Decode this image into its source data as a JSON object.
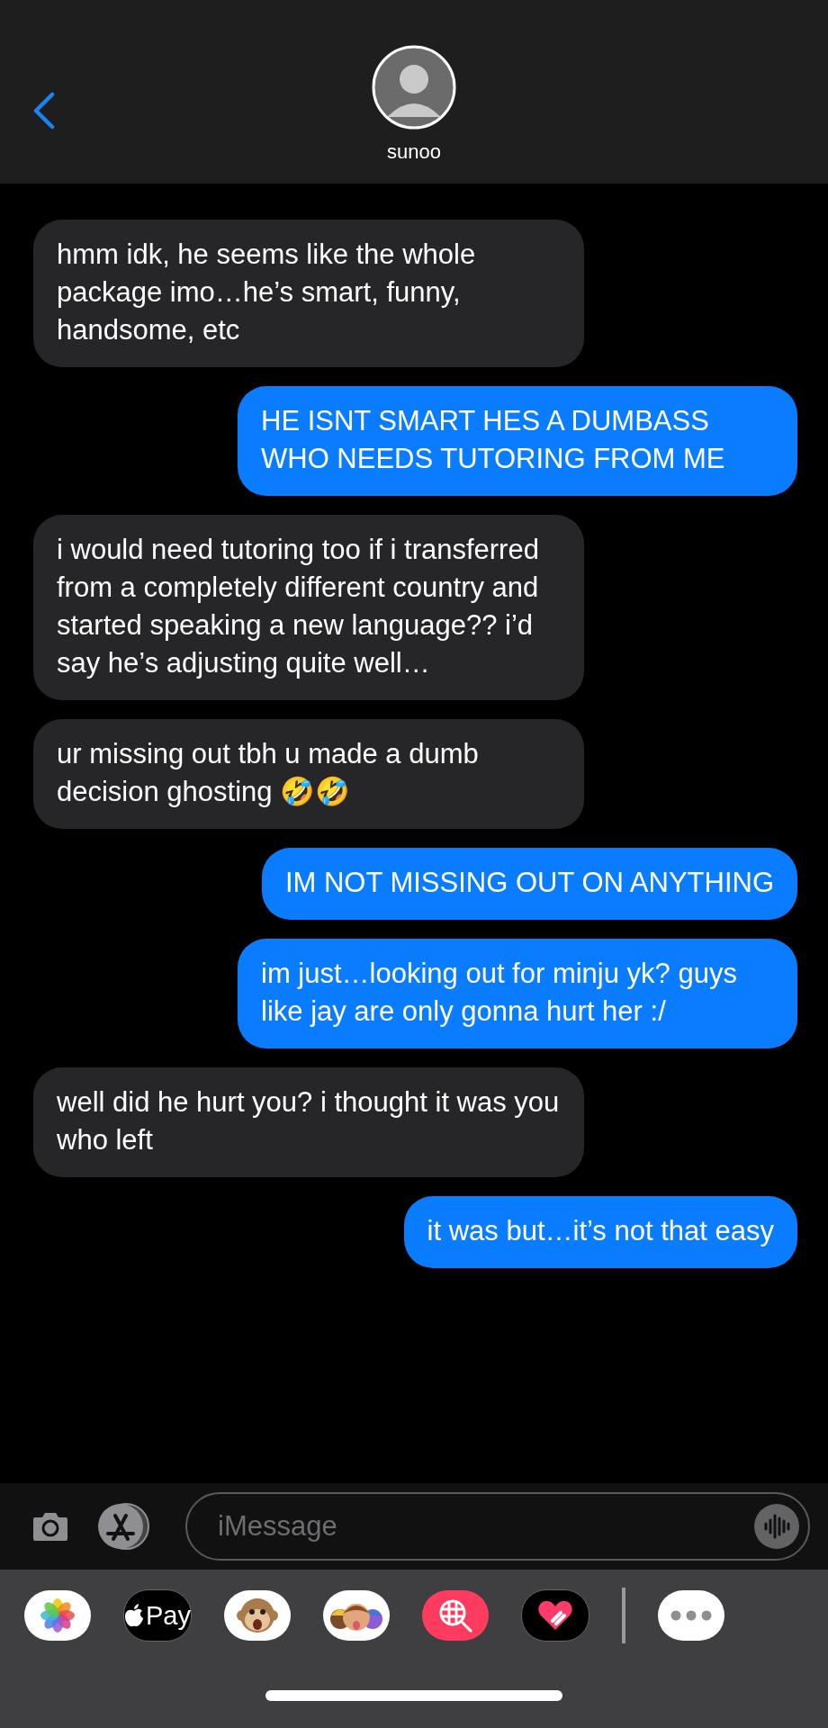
{
  "header": {
    "contact_name": "sunoo"
  },
  "messages": [
    {
      "kind": "received",
      "text": "hmm idk, he seems like the whole package imo…he’s smart, funny, handsome, etc"
    },
    {
      "kind": "sent",
      "text": "HE ISNT SMART HES A DUMBASS WHO NEEDS TUTORING FROM ME"
    },
    {
      "kind": "received",
      "text": "i would need tutoring too if i transferred from a completely different country and started speaking a new language?? i’d say he’s adjusting quite well…"
    },
    {
      "kind": "received",
      "text": "ur missing out tbh u made a dumb decision ghosting 🤣🤣"
    },
    {
      "kind": "sent",
      "text": "IM NOT MISSING OUT ON ANYTHING"
    },
    {
      "kind": "sent",
      "text": "im just…looking out for minju yk? guys like jay are only gonna hurt her :/"
    },
    {
      "kind": "received",
      "text": "well did he hurt you? i thought it was you who left"
    },
    {
      "kind": "sent",
      "text": "it was but…it’s not that easy"
    }
  ],
  "composer": {
    "placeholder": "iMessage"
  },
  "app_drawer": {
    "apple_pay_label": "Pay"
  }
}
